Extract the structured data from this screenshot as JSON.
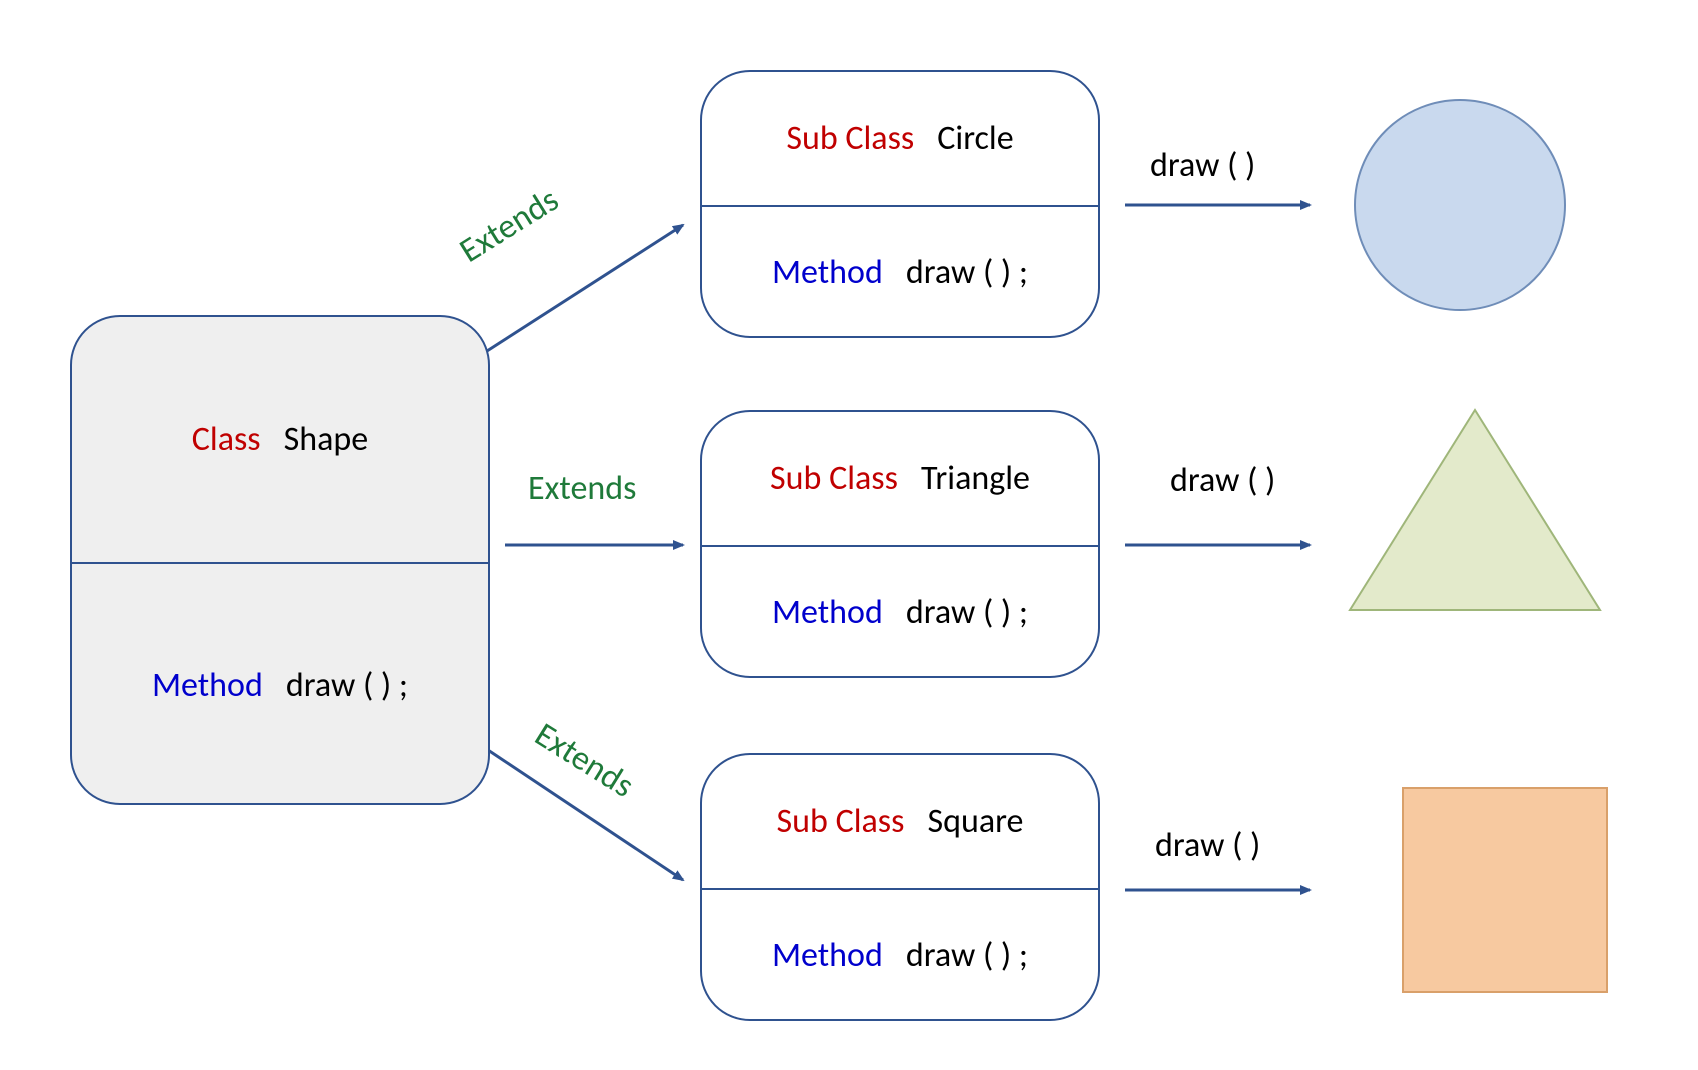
{
  "keywords": {
    "class": "Class",
    "subclass": "Sub Class",
    "method": "Method",
    "extends": "Extends"
  },
  "parent": {
    "name": "Shape",
    "method": "draw ( ) ;"
  },
  "children": [
    {
      "name": "Circle",
      "method": "draw ( ) ;",
      "call": "draw ( )",
      "shape": "circle"
    },
    {
      "name": "Triangle",
      "method": "draw ( ) ;",
      "call": "draw ( )",
      "shape": "triangle"
    },
    {
      "name": "Square",
      "method": "draw ( ) ;",
      "call": "draw ( )",
      "shape": "square"
    }
  ],
  "colors": {
    "border": "#2f528f",
    "arrow": "#2f528f",
    "red": "#c00000",
    "blue": "#0000cc",
    "green": "#1f7a3a",
    "circleFill": "#c9d9ee",
    "circleStroke": "#6f8db8",
    "triangleFill": "#e3eacb",
    "triangleStroke": "#9fb67a",
    "squareFill": "#f7c9a0",
    "squareStroke": "#d9a06a",
    "parentFill": "#efefef"
  }
}
